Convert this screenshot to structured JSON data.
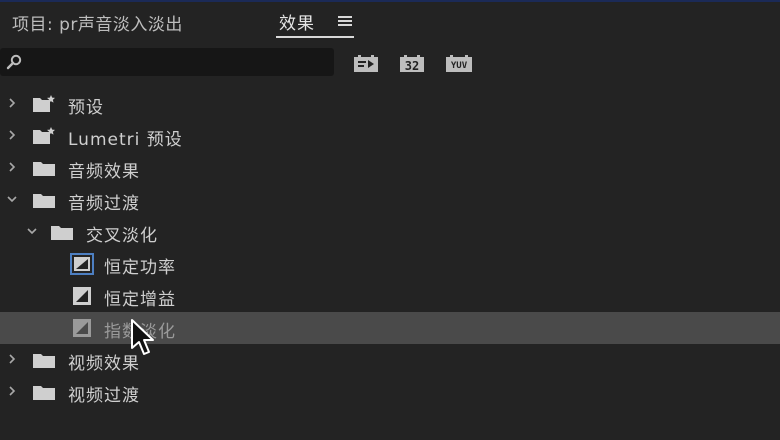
{
  "tabs": {
    "project_title": "项目: pr声音淡入淡出",
    "effects_title": "效果"
  },
  "search": {
    "value": "",
    "placeholder": ""
  },
  "toolbar": {
    "buttons": [
      {
        "icon": "accelerated-effects-icon",
        "text": ""
      },
      {
        "icon": "32-bit-color-icon",
        "text": "32"
      },
      {
        "icon": "yuv-effects-icon",
        "text": "YUV"
      }
    ]
  },
  "tree": {
    "items": [
      {
        "label": "预设",
        "icon": "folder-star-icon",
        "expanded": false,
        "level": 0
      },
      {
        "label": "Lumetri 预设",
        "icon": "folder-star-icon",
        "expanded": false,
        "level": 0
      },
      {
        "label": "音频效果",
        "icon": "folder-icon",
        "expanded": false,
        "level": 0
      },
      {
        "label": "音频过渡",
        "icon": "folder-icon",
        "expanded": true,
        "level": 0
      },
      {
        "label": "交叉淡化",
        "icon": "folder-icon",
        "expanded": true,
        "level": 1
      },
      {
        "label": "恒定功率",
        "icon": "audio-transition-icon",
        "level": 2,
        "default": true
      },
      {
        "label": "恒定增益",
        "icon": "audio-transition-icon",
        "level": 2
      },
      {
        "label": "指数淡化",
        "icon": "audio-transition-icon",
        "level": 2,
        "selected": true
      },
      {
        "label": "视频效果",
        "icon": "folder-icon",
        "expanded": false,
        "level": 0
      },
      {
        "label": "视频过渡",
        "icon": "folder-icon",
        "expanded": false,
        "level": 0
      }
    ]
  },
  "colors": {
    "background": "#232323",
    "selected_row": "#4a4a4a",
    "top_accent": "#1b2a57"
  }
}
